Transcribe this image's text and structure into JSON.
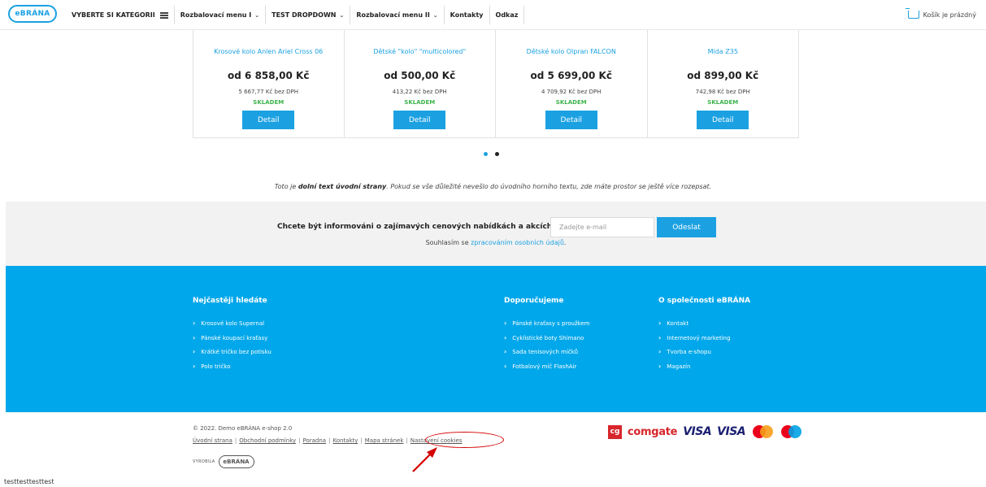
{
  "nav": {
    "logo": "eBRÁNA",
    "items": [
      {
        "label": "VYBERTE SI KATEGORII",
        "has_hamburger": true
      },
      {
        "label": "Rozbalovací menu I",
        "has_caret": true
      },
      {
        "label": "TEST DROPDOWN",
        "has_caret": true
      },
      {
        "label": "Rozbalovací menu II",
        "has_caret": true
      },
      {
        "label": "Kontakty"
      },
      {
        "label": "Odkaz"
      }
    ],
    "cart_label": "Košík je prázdný"
  },
  "products": [
    {
      "name": "Krosové kolo Anlen Ariel Cross 06",
      "price": "od 6 858,00 Kč",
      "net_price": "5 667,77 Kč bez DPH",
      "stock": "SKLADEM",
      "button": "Detail"
    },
    {
      "name": "Dětské \"kolo\" \"multicolored\"",
      "price": "od 500,00 Kč",
      "net_price": "413,22 Kč bez DPH",
      "stock": "SKLADEM",
      "button": "Detail"
    },
    {
      "name": "Dětské kolo Olpran FALCON",
      "price": "od 5 699,00 Kč",
      "net_price": "4 709,92 Kč bez DPH",
      "stock": "SKLADEM",
      "button": "Detail"
    },
    {
      "name": "Mida Z35",
      "price": "od 899,00 Kč",
      "net_price": "742,98 Kč bez DPH",
      "stock": "SKLADEM",
      "button": "Detail"
    }
  ],
  "bottom_text": {
    "prefix": "Toto je ",
    "bold": "dolní text úvodní strany",
    "suffix": ". Pokud se vše důležité nevešlo do úvodního horního textu, zde máte prostor se ještě více rozepsat."
  },
  "newsletter": {
    "question": "Chcete být informováni o zajímavých cenových nabídkách a akcích?",
    "email_placeholder": "Zadejte e-mail",
    "submit": "Odeslat",
    "consent_prefix": "Souhlasím se ",
    "consent_link": "zpracováním osobních údajů",
    "consent_suffix": "."
  },
  "footer": {
    "columns": [
      {
        "title": "Nejčastěji hledáte",
        "items": [
          "Krosové kolo Supernal",
          "Pánské koupací kraťasy",
          "Krátké tričko bez potisku",
          "Polo tričko"
        ]
      },
      {
        "title": "Doporučujeme",
        "items": [
          "Pánské kraťasy s proužkem",
          "Cyklistické boty Shimano",
          "Sada tenisových míčků",
          "Fotbalový míč FlashAir"
        ]
      },
      {
        "title": "O společnosti eBRÁNA",
        "items": [
          "Kontakt",
          "Internetový marketing",
          "Tvorba e-shopu",
          "Magazín"
        ]
      }
    ],
    "copyright": "© 2022. Demo eBRÁNA e-shop 2.0",
    "links": [
      "Úvodní strana",
      "Obchodní podmínky",
      "Poradna",
      "Kontakty",
      "Mapa stránek",
      "Nastavení cookies"
    ],
    "made_by_label": "VYROBILA",
    "made_by_logo": "eBRÁNA",
    "payments": {
      "cg": "cg",
      "comgate": "comgate",
      "visa1": "VISA",
      "visa2": "VISA"
    }
  },
  "test_text": "testtesttesttest",
  "colors": {
    "accent": "#00a7ea",
    "stock": "#3cb44b",
    "annotation": "#d40000"
  }
}
